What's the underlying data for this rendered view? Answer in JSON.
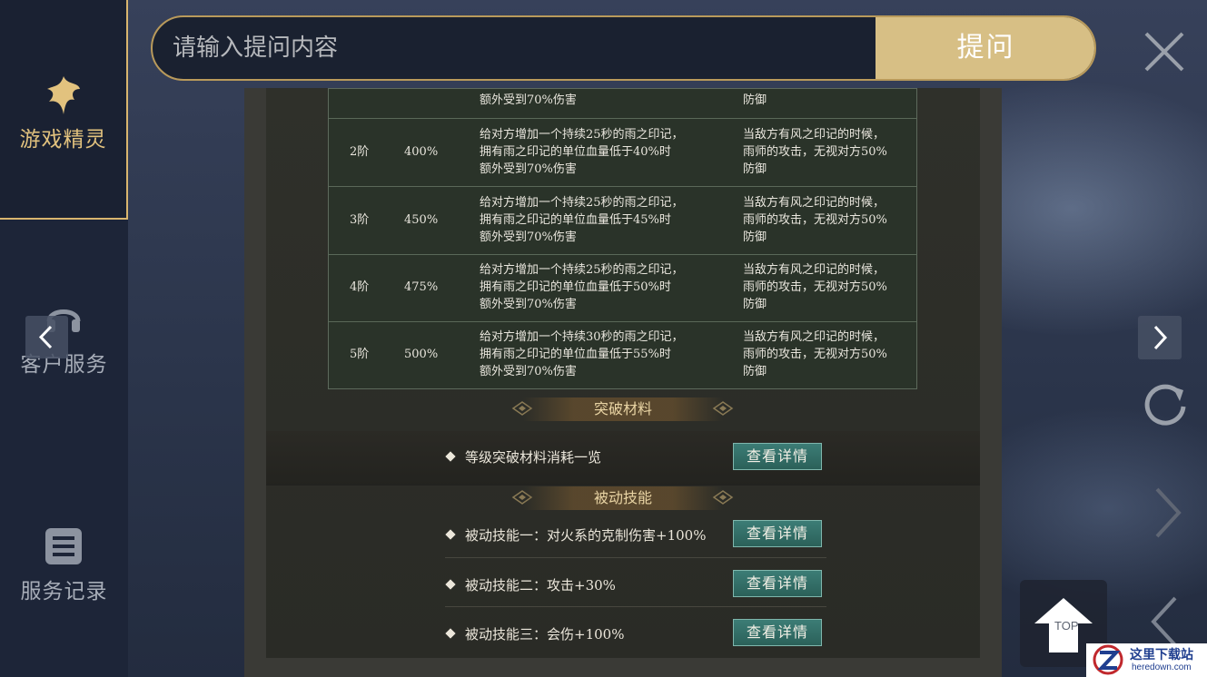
{
  "sidebar": {
    "items": [
      {
        "label": "游戏精灵",
        "icon": "fairy-icon",
        "active": true
      },
      {
        "label": "客户服务",
        "icon": "headset-icon",
        "active": false
      },
      {
        "label": "服务记录",
        "icon": "list-icon",
        "active": false
      }
    ]
  },
  "search": {
    "placeholder": "请输入提问内容",
    "button_label": "提问"
  },
  "stage_table": {
    "top_partial": {
      "effect_line": "额外受到70%伤害",
      "extra_line": "防御"
    },
    "rows": [
      {
        "stage": "2阶",
        "percent": "400%",
        "effect": [
          "给对方增加一个持续25秒的雨之印记，",
          "拥有雨之印记的单位血量低于40%时",
          "额外受到70%伤害"
        ],
        "extra": [
          "当敌方有风之印记的时候，",
          "雨师的攻击，无视对方50%",
          "防御"
        ]
      },
      {
        "stage": "3阶",
        "percent": "450%",
        "effect": [
          "给对方增加一个持续25秒的雨之印记，",
          "拥有雨之印记的单位血量低于45%时",
          "额外受到70%伤害"
        ],
        "extra": [
          "当敌方有风之印记的时候，",
          "雨师的攻击，无视对方50%",
          "防御"
        ]
      },
      {
        "stage": "4阶",
        "percent": "475%",
        "effect": [
          "给对方增加一个持续25秒的雨之印记，",
          "拥有雨之印记的单位血量低于50%时",
          "额外受到70%伤害"
        ],
        "extra": [
          "当敌方有风之印记的时候，",
          "雨师的攻击，无视对方50%",
          "防御"
        ]
      },
      {
        "stage": "5阶",
        "percent": "500%",
        "effect": [
          "给对方增加一个持续30秒的雨之印记，",
          "拥有雨之印记的单位血量低于55%时",
          "额外受到70%伤害"
        ],
        "extra": [
          "当敌方有风之印记的时候，",
          "雨师的攻击，无视对方50%",
          "防御"
        ]
      }
    ]
  },
  "breakthrough": {
    "title": "突破材料",
    "item": "等级突破材料消耗一览",
    "button_label": "查看详情"
  },
  "passive": {
    "title": "被动技能",
    "items": [
      {
        "text": "被动技能一：对火系的克制伤害+100%",
        "button_label": "查看详情"
      },
      {
        "text": "被动技能二：攻击+30%",
        "button_label": "查看详情"
      },
      {
        "text": "被动技能三：会伤+100%",
        "button_label": "查看详情"
      }
    ]
  },
  "controls": {
    "top_label": "TOP",
    "icons": [
      "close-icon",
      "chevron-left-icon",
      "chevron-right-icon",
      "refresh-icon",
      "next-icon",
      "prev-icon"
    ]
  },
  "watermark": {
    "text": "这里下载站",
    "sub": "heredown.com"
  }
}
